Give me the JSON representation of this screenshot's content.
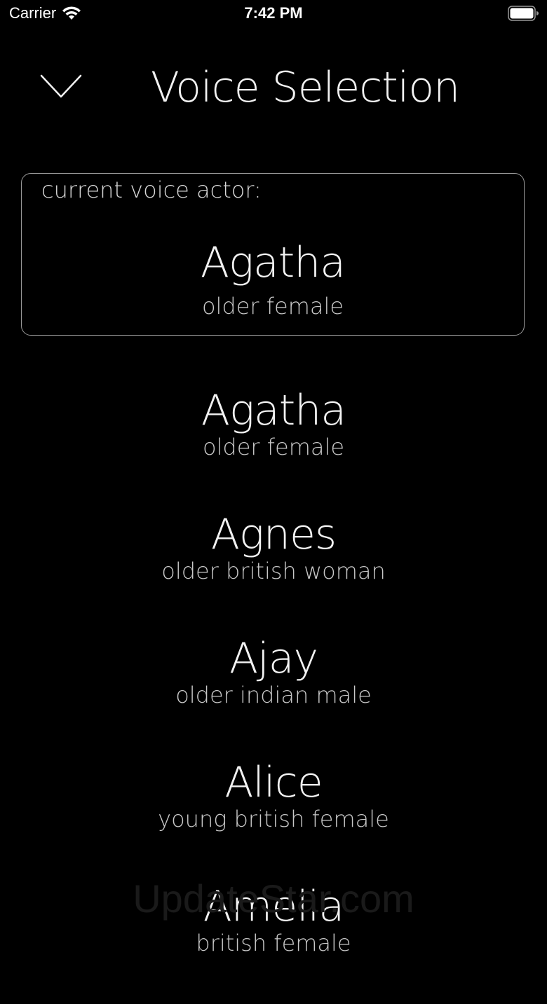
{
  "status_bar": {
    "carrier": "Carrier",
    "time": "7:42 PM"
  },
  "header": {
    "title": "Voice Selection"
  },
  "current_voice": {
    "label": "current voice actor:",
    "name": "Agatha",
    "description": "older female"
  },
  "voices": [
    {
      "name": "Agatha",
      "description": "older female"
    },
    {
      "name": "Agnes",
      "description": "older british woman"
    },
    {
      "name": "Ajay",
      "description": "older indian male"
    },
    {
      "name": "Alice",
      "description": "young british female"
    },
    {
      "name": "Amelia",
      "description": "british female"
    }
  ],
  "watermark": "UpdateStar.com",
  "colors": {
    "background": "#000000",
    "text": "#f2f2f2",
    "border": "#9a9a9a"
  }
}
